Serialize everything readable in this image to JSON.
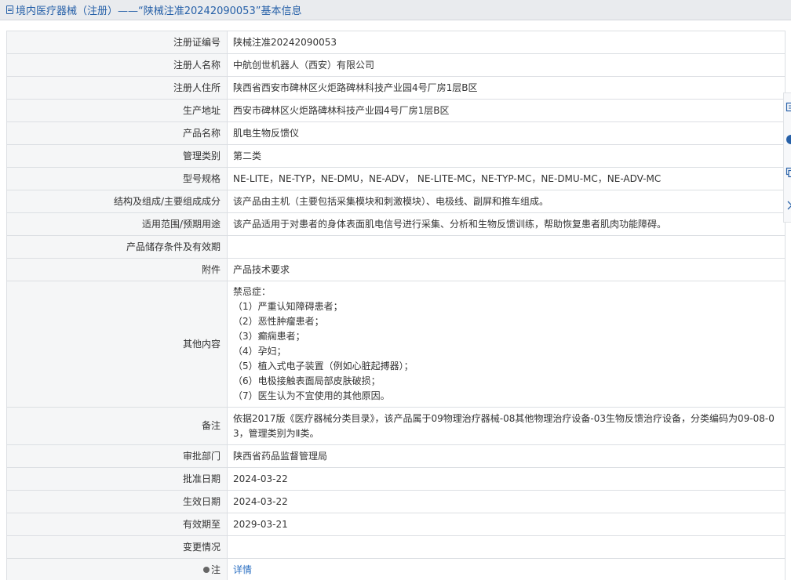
{
  "header": {
    "title": "境内医疗器械（注册）——“陕械注准20242090053”基本信息"
  },
  "rows": [
    {
      "label": "注册证编号",
      "value": "陕械注准20242090053"
    },
    {
      "label": "注册人名称",
      "value": "中航创世机器人（西安）有限公司"
    },
    {
      "label": "注册人住所",
      "value": "陕西省西安市碑林区火炬路碑林科技产业园4号厂房1层B区"
    },
    {
      "label": "生产地址",
      "value": "西安市碑林区火炬路碑林科技产业园4号厂房1层B区"
    },
    {
      "label": "产品名称",
      "value": "肌电生物反馈仪"
    },
    {
      "label": "管理类别",
      "value": "第二类"
    },
    {
      "label": "型号规格",
      "value": "NE-LITE，NE-TYP，NE-DMU，NE-ADV， NE-LITE-MC，NE-TYP-MC，NE-DMU-MC，NE-ADV-MC"
    },
    {
      "label": "结构及组成/主要组成成分",
      "value": "该产品由主机（主要包括采集模块和刺激模块）、电极线、副屏和推车组成。"
    },
    {
      "label": "适用范围/预期用途",
      "value": "该产品适用于对患者的身体表面肌电信号进行采集、分析和生物反馈训练，帮助恢复患者肌肉功能障碍。"
    },
    {
      "label": "产品储存条件及有效期",
      "value": ""
    },
    {
      "label": "附件",
      "value": "产品技术要求"
    }
  ],
  "other": {
    "label": "其他内容",
    "lines": [
      "禁忌症：",
      "（1）严重认知障碍患者；",
      "（2）恶性肿瘤患者；",
      "（3）癫痫患者；",
      "（4）孕妇；",
      "（5）植入式电子装置（例如心脏起搏器）；",
      "（6）电极接触表面局部皮肤破损；",
      "（7）医生认为不宜使用的其他原因。"
    ]
  },
  "remark": {
    "label": "备注",
    "value": "依据2017版《医疗器械分类目录》，该产品属于09物理治疗器械-08其他物理治疗设备-03生物反馈治疗设备，分类编码为09-08-03，管理类别为Ⅱ类。"
  },
  "rows2": [
    {
      "label": "审批部门",
      "value": "陕西省药品监督管理局"
    },
    {
      "label": "批准日期",
      "value": "2024-03-22"
    },
    {
      "label": "生效日期",
      "value": "2024-03-22"
    },
    {
      "label": "有效期至",
      "value": "2029-03-21"
    },
    {
      "label": "变更情况",
      "value": ""
    }
  ],
  "note": {
    "label": "注",
    "link": "详情"
  },
  "icons": {
    "title": "document-icon",
    "note": "pin-icon",
    "side": [
      "copy-icon",
      "help-icon",
      "duplicate-icon",
      "chevron-right-icon"
    ]
  },
  "colors": {
    "link": "#2b6fc2",
    "title": "#2660a8",
    "label_bg": "#f5f6f7",
    "border": "#dcdfe3"
  }
}
